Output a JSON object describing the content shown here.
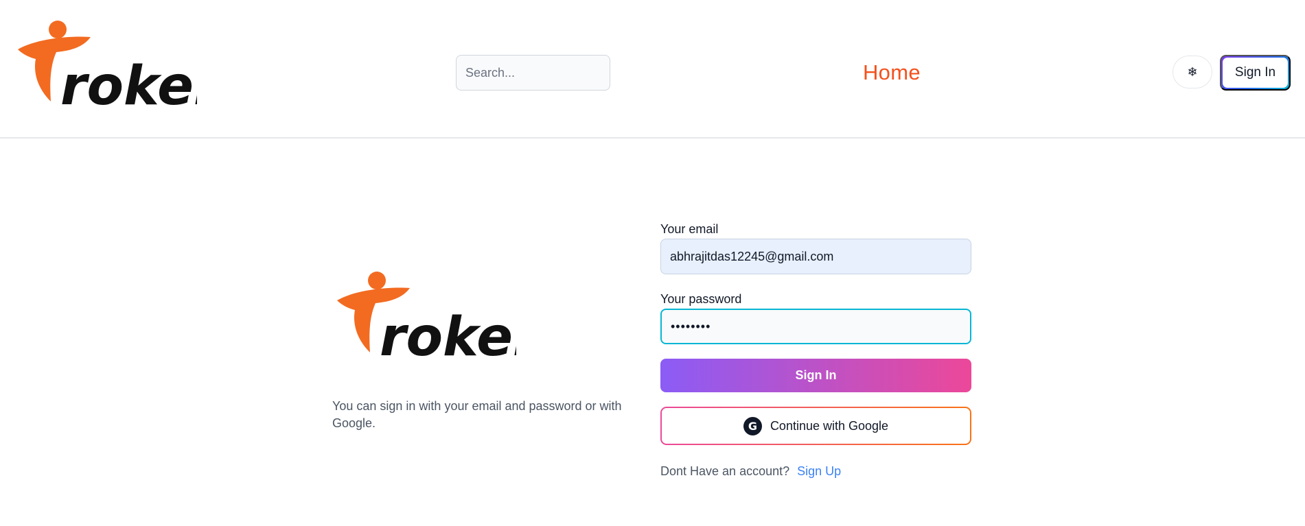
{
  "brand": {
    "logo_alt": "Froker",
    "logo_text": "roker",
    "colors": {
      "accent": "#f4511e",
      "logo_orange": "#f26b21"
    }
  },
  "header": {
    "search": {
      "placeholder": "Search...",
      "value": ""
    },
    "nav_home": "Home",
    "theme_toggle_icon": "❄",
    "sign_in": "Sign In"
  },
  "main": {
    "helper_text": "You can sign in with your email and password or with Google.",
    "form": {
      "email_label": "Your email",
      "email_value": "abhrajitdas12245@gmail.com",
      "password_label": "Your password",
      "password_value": "••••••••",
      "submit_label": "Sign In",
      "google_label": "Continue with Google",
      "google_icon": "G",
      "signup_prompt": "Dont Have an account?",
      "signup_link": "Sign Up"
    }
  }
}
